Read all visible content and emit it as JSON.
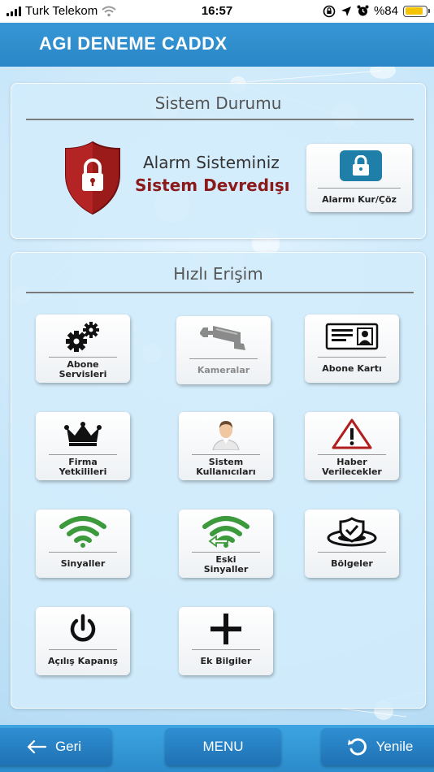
{
  "status_bar": {
    "carrier": "Turk Telekom",
    "time": "16:57",
    "battery_text": "%84",
    "battery_level": 0.84,
    "icons": [
      "signal-icon",
      "wifi-icon",
      "screen-lock-icon",
      "location-icon",
      "alarm-clock-icon",
      "battery-icon"
    ]
  },
  "header": {
    "title": "AGI DENEME CADDX"
  },
  "system_status": {
    "title": "Sistem Durumu",
    "line1": "Alarm Sisteminiz",
    "line2": "Sistem Devredışı",
    "button_label": "Alarmı Kur/Çöz",
    "colors": {
      "shield": "#9b1b1b",
      "status_text": "#8b1a1a",
      "lock_box": "#1f7fa8"
    }
  },
  "quick_access": {
    "title": "Hızlı Erişim",
    "tiles": [
      {
        "label": "Abone Servisleri",
        "lines": [
          "Abone",
          "Servisleri"
        ],
        "icon": "gears-icon"
      },
      {
        "label": "Kameralar",
        "lines": [
          "Kameralar"
        ],
        "icon": "camera-icon",
        "disabled": true
      },
      {
        "label": "Abone Kartı",
        "lines": [
          "Abone Kartı"
        ],
        "icon": "id-card-icon"
      },
      {
        "label": "Firma Yetkilileri",
        "lines": [
          "Firma",
          "Yetkilileri"
        ],
        "icon": "crown-icon"
      },
      {
        "label": "Sistem Kullanıcıları",
        "lines": [
          "Sistem",
          "Kullanıcıları"
        ],
        "icon": "user-icon"
      },
      {
        "label": "Haber Verilecekler",
        "lines": [
          "Haber",
          "Verilecekler"
        ],
        "icon": "warning-icon"
      },
      {
        "label": "Sinyaller",
        "lines": [
          "Sinyaller"
        ],
        "icon": "wifi-signal-icon"
      },
      {
        "label": "Eski Sinyaller",
        "lines": [
          "Eski",
          "Sinyaller"
        ],
        "icon": "old-signal-icon"
      },
      {
        "label": "Bölgeler",
        "lines": [
          "Bölgeler"
        ],
        "icon": "zones-icon"
      },
      {
        "label": "Açılış Kapanış",
        "lines": [
          "Açılış Kapanış"
        ],
        "icon": "power-icon"
      },
      {
        "label": "Ek Bilgiler",
        "lines": [
          "Ek Bilgiler"
        ],
        "icon": "plus-icon"
      }
    ]
  },
  "bottom_nav": {
    "back": "Geri",
    "menu": "MENU",
    "refresh": "Yenile"
  }
}
